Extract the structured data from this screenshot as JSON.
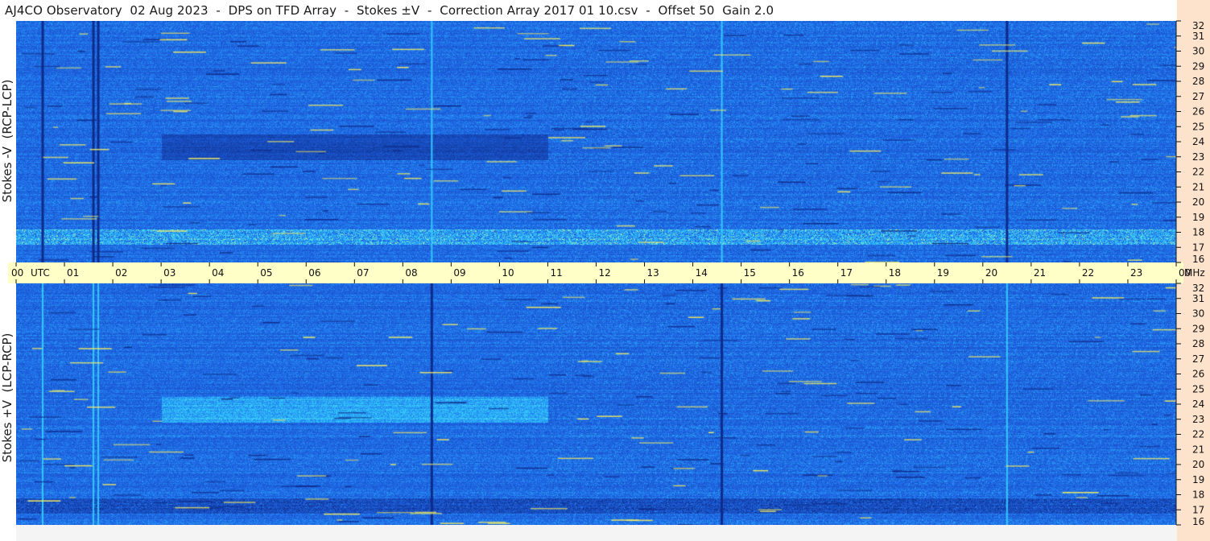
{
  "title": "AJ4CO Observatory  02 Aug 2023  -  DPS on TFD Array  -  Stokes ±V  -  Correction Array 2017 01 10.csv  -  Offset 50  Gain 2.0",
  "colors": {
    "base": "#1f5fe0",
    "dark": "#0d2a8a",
    "cyan": "#33c8ff",
    "yellow": "#f8f060",
    "axis_band": "#ffffc8",
    "freq_strip": "#fde3cc"
  },
  "chart_data": [
    {
      "type": "heatmap",
      "ylabel": "Stokes -V  (RCP-LCP)",
      "xlabel": "UTC",
      "ylabel_right": "MHz",
      "x_ticks": [
        "00",
        "01",
        "02",
        "03",
        "04",
        "05",
        "06",
        "07",
        "08",
        "09",
        "10",
        "11",
        "12",
        "13",
        "14",
        "15",
        "16",
        "17",
        "18",
        "19",
        "20",
        "21",
        "22",
        "23",
        "00"
      ],
      "y_ticks": [
        16,
        17,
        18,
        19,
        20,
        21,
        22,
        23,
        24,
        25,
        26,
        27,
        28,
        29,
        30,
        31,
        32
      ],
      "xlim": [
        0,
        24
      ],
      "ylim": [
        16,
        32
      ],
      "features": [
        {
          "kind": "dark_vertical",
          "utc": 0.55
        },
        {
          "kind": "dark_vertical",
          "utc": 1.6
        },
        {
          "kind": "dark_vertical",
          "utc": 1.7
        },
        {
          "kind": "cyan_vertical",
          "utc": 8.6
        },
        {
          "kind": "cyan_vertical",
          "utc": 14.6
        },
        {
          "kind": "dark_vertical",
          "utc": 20.5
        },
        {
          "kind": "dark_block",
          "utc_start": 3.0,
          "utc_end": 11.0,
          "mhz_start": 22.8,
          "mhz_end": 24.5
        },
        {
          "kind": "bright_band",
          "utc_start": 0,
          "utc_end": 24,
          "mhz_start": 17.2,
          "mhz_end": 18.2
        }
      ]
    },
    {
      "type": "heatmap",
      "ylabel": "Stokes +V  (LCP-RCP)",
      "xlabel": "UTC",
      "ylabel_right": "MHz",
      "x_ticks": [
        "00",
        "01",
        "02",
        "03",
        "04",
        "05",
        "06",
        "07",
        "08",
        "09",
        "10",
        "11",
        "12",
        "13",
        "14",
        "15",
        "16",
        "17",
        "18",
        "19",
        "20",
        "21",
        "22",
        "23",
        "00"
      ],
      "y_ticks": [
        16,
        17,
        18,
        19,
        20,
        21,
        22,
        23,
        24,
        25,
        26,
        27,
        28,
        29,
        30,
        31,
        32
      ],
      "xlim": [
        0,
        24
      ],
      "ylim": [
        16,
        32
      ],
      "features": [
        {
          "kind": "cyan_vertical",
          "utc": 0.55
        },
        {
          "kind": "cyan_vertical",
          "utc": 1.6
        },
        {
          "kind": "cyan_vertical",
          "utc": 1.7
        },
        {
          "kind": "dark_vertical",
          "utc": 8.6
        },
        {
          "kind": "dark_vertical",
          "utc": 14.6
        },
        {
          "kind": "cyan_vertical",
          "utc": 20.5
        },
        {
          "kind": "light_block",
          "utc_start": 3.0,
          "utc_end": 11.0,
          "mhz_start": 22.8,
          "mhz_end": 24.5
        },
        {
          "kind": "dark_band",
          "utc_start": 0,
          "utc_end": 24,
          "mhz_start": 16.8,
          "mhz_end": 17.8
        }
      ]
    }
  ]
}
